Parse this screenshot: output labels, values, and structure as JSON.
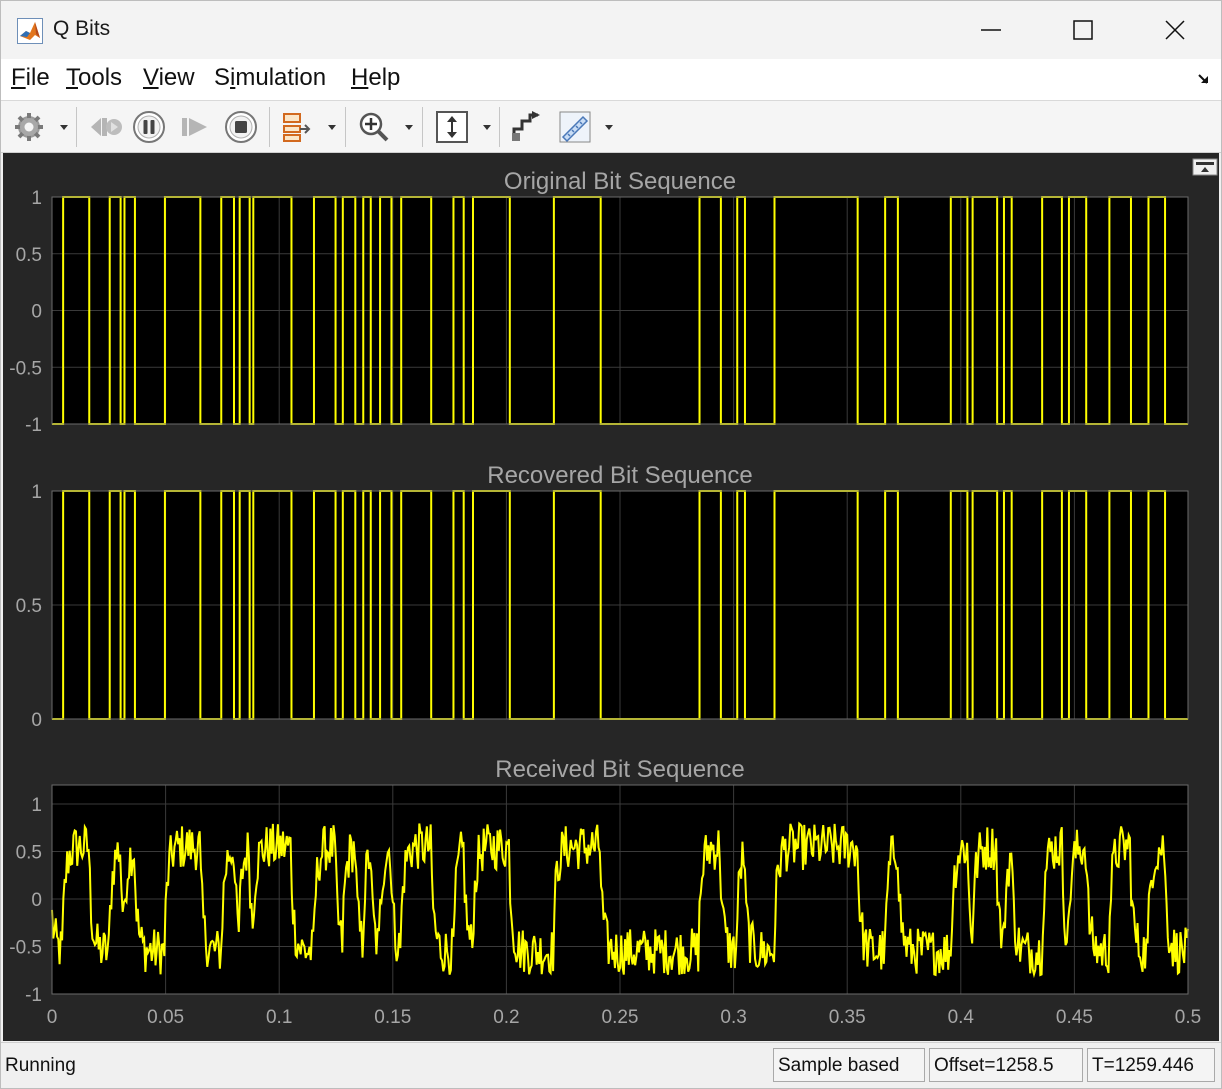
{
  "window": {
    "title": "Q Bits",
    "app_icon": "matlab-logo-icon",
    "controls": [
      "minimize-icon",
      "maximize-icon",
      "close-icon"
    ]
  },
  "menu": {
    "items": [
      {
        "label": "File",
        "mnemonic": "F"
      },
      {
        "label": "Tools",
        "mnemonic": "T"
      },
      {
        "label": "View",
        "mnemonic": "V"
      },
      {
        "label": "Simulation",
        "mnemonic": "i"
      },
      {
        "label": "Help",
        "mnemonic": "H"
      }
    ],
    "undock_icon": "undock-arrow-icon"
  },
  "toolbar": {
    "buttons": [
      "settings-gear-icon",
      "step-back-icon",
      "pause-icon",
      "step-forward-icon",
      "stop-icon",
      "signal-hierarchy-icon",
      "zoom-in-icon",
      "scale-axes-icon",
      "highlight-simulink-block-icon",
      "measurements-ruler-icon"
    ]
  },
  "scope": {
    "background": "#262626",
    "axes_background": "#000000",
    "trace_color": "#ffff00",
    "label_color": "#a6a6a6",
    "grid_color": "#3a3a3a",
    "restore_icon": "restore-layout-icon"
  },
  "chart_data": [
    {
      "type": "line",
      "title": "Original Bit Sequence",
      "xlim": [
        0,
        0.5
      ],
      "ylim": [
        -1,
        1
      ],
      "yticks": [
        "1",
        "0.5",
        "0",
        "-0.5",
        "-1"
      ],
      "xticks": [],
      "signal": "bipolar NRZ square wave, levels -1 / 1",
      "transitions_x": [
        0.0049,
        0.0164,
        0.0254,
        0.0302,
        0.0319,
        0.0365,
        0.0497,
        0.0653,
        0.0745,
        0.0801,
        0.0826,
        0.087,
        0.0886,
        0.1054,
        0.1153,
        0.1248,
        0.128,
        0.1335,
        0.137,
        0.1403,
        0.1444,
        0.1494,
        0.1537,
        0.1669,
        0.1767,
        0.1812,
        0.1853,
        0.2015,
        0.2209,
        0.2415,
        0.285,
        0.2944,
        0.3016,
        0.305,
        0.318,
        0.3546,
        0.3667,
        0.3723,
        0.3956,
        0.4029,
        0.4052,
        0.416,
        0.419,
        0.4224,
        0.4358,
        0.4445,
        0.4476,
        0.4552,
        0.4654,
        0.4749,
        0.4826,
        0.4899
      ],
      "start_level": -1,
      "series": [
        {
          "values": "-1 / 1 levels between transitions"
        }
      ]
    },
    {
      "type": "line",
      "title": "Recovered Bit Sequence",
      "xlim": [
        0,
        0.5
      ],
      "ylim": [
        0,
        1
      ],
      "yticks": [
        "1",
        "0.5",
        "0"
      ],
      "xticks": [],
      "signal": "unipolar NRZ square wave, levels 0 / 1",
      "transitions_x": [
        0.0049,
        0.0164,
        0.0254,
        0.0302,
        0.0319,
        0.0365,
        0.0497,
        0.0653,
        0.0745,
        0.0801,
        0.0826,
        0.087,
        0.0886,
        0.1054,
        0.1153,
        0.1248,
        0.128,
        0.1335,
        0.137,
        0.1403,
        0.1444,
        0.1494,
        0.1537,
        0.1669,
        0.1767,
        0.1812,
        0.1853,
        0.2015,
        0.2209,
        0.2415,
        0.285,
        0.2944,
        0.3016,
        0.305,
        0.318,
        0.3546,
        0.3667,
        0.3723,
        0.3956,
        0.4029,
        0.4052,
        0.416,
        0.419,
        0.4224,
        0.4358,
        0.4445,
        0.4476,
        0.4552,
        0.4654,
        0.4749,
        0.4826,
        0.4899
      ],
      "start_level": 0
    },
    {
      "type": "line",
      "title": "Received Bit Sequence",
      "xlim": [
        0,
        0.5
      ],
      "ylim": [
        -1,
        1.2
      ],
      "yticks": [
        "1",
        "0.5",
        "0",
        "-0.5",
        "-1"
      ],
      "xticks": [
        "0",
        "0.05",
        "0.1",
        "0.15",
        "0.2",
        "0.25",
        "0.3",
        "0.35",
        "0.4",
        "0.45",
        "0.5"
      ],
      "signal": "noisy soft values around -0.55 / 0.55 following the original bit pattern",
      "level_high": 0.55,
      "level_low": -0.55,
      "noise_amplitude": 0.25
    }
  ],
  "status": {
    "state": "Running",
    "mode": "Sample based",
    "offset": "Offset=1258.5",
    "time": "T=1259.446"
  }
}
